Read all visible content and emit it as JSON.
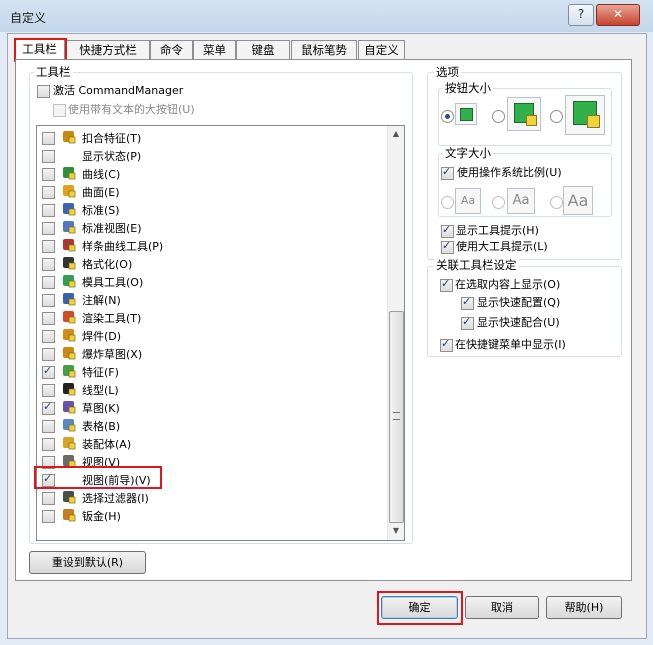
{
  "window": {
    "title": "自定义",
    "help_label": "?",
    "close_label": "✕"
  },
  "tabs": [
    {
      "label": "工具栏"
    },
    {
      "label": "快捷方式栏"
    },
    {
      "label": "命令"
    },
    {
      "label": "菜单"
    },
    {
      "label": "键盘"
    },
    {
      "label": "鼠标笔势"
    },
    {
      "label": "自定义"
    }
  ],
  "toolbars_group": {
    "title": "工具栏",
    "activate_cm": "激活 CommandManager",
    "large_buttons": "使用带有文本的大按钮(U)",
    "items": [
      {
        "label": "扣合特征(T)",
        "checked": false,
        "icon": "snap-feature-icon"
      },
      {
        "label": "显示状态(P)",
        "checked": false,
        "icon": ""
      },
      {
        "label": "曲线(C)",
        "checked": false,
        "icon": "curve-icon"
      },
      {
        "label": "曲面(E)",
        "checked": false,
        "icon": "surface-icon"
      },
      {
        "label": "标准(S)",
        "checked": false,
        "icon": "standard-icon"
      },
      {
        "label": "标准视图(E)",
        "checked": false,
        "icon": "standard-views-icon"
      },
      {
        "label": "样条曲线工具(P)",
        "checked": false,
        "icon": "spline-tools-icon"
      },
      {
        "label": "格式化(O)",
        "checked": false,
        "icon": "format-icon"
      },
      {
        "label": "模具工具(O)",
        "checked": false,
        "icon": "mold-tools-icon"
      },
      {
        "label": "注解(N)",
        "checked": false,
        "icon": "annotation-icon"
      },
      {
        "label": "渲染工具(T)",
        "checked": false,
        "icon": "render-tools-icon"
      },
      {
        "label": "焊件(D)",
        "checked": false,
        "icon": "weldments-icon"
      },
      {
        "label": "爆炸草图(X)",
        "checked": false,
        "icon": "explode-sketch-icon"
      },
      {
        "label": "特征(F)",
        "checked": true,
        "icon": "features-icon"
      },
      {
        "label": "线型(L)",
        "checked": false,
        "icon": "line-format-icon"
      },
      {
        "label": "草图(K)",
        "checked": true,
        "icon": "sketch-icon"
      },
      {
        "label": "表格(B)",
        "checked": false,
        "icon": "table-icon"
      },
      {
        "label": "装配体(A)",
        "checked": false,
        "icon": "assembly-icon"
      },
      {
        "label": "视图(V)",
        "checked": false,
        "icon": "view-icon"
      },
      {
        "label": "视图(前导)(V)",
        "checked": true,
        "icon": ""
      },
      {
        "label": "选择过滤器(I)",
        "checked": false,
        "icon": "selection-filter-icon"
      },
      {
        "label": "钣金(H)",
        "checked": false,
        "icon": "sheet-metal-icon"
      }
    ],
    "reset_button": "重设到默认(R)"
  },
  "options_group": {
    "title": "选项",
    "button_size": "按钮大小",
    "text_size": "文字大小",
    "use_system_scale": "使用操作系统比例(U)",
    "aa_label": "Aa",
    "show_tooltips": "显示工具提示(H)",
    "use_large_tooltips": "使用大工具提示(L)"
  },
  "context_group": {
    "title": "关联工具栏设定",
    "show_in_selection": "在选取内容上显示(O)",
    "show_quick_config": "显示快速配置(Q)",
    "show_quick_mate": "显示快速配合(U)",
    "show_in_shortcut": "在快捷键菜单中显示(I)"
  },
  "footer": {
    "ok": "确定",
    "cancel": "取消",
    "help": "帮助(H)"
  },
  "colors": {
    "highlight_red": "#e0161f",
    "accent_blue": "#2a4f86"
  }
}
